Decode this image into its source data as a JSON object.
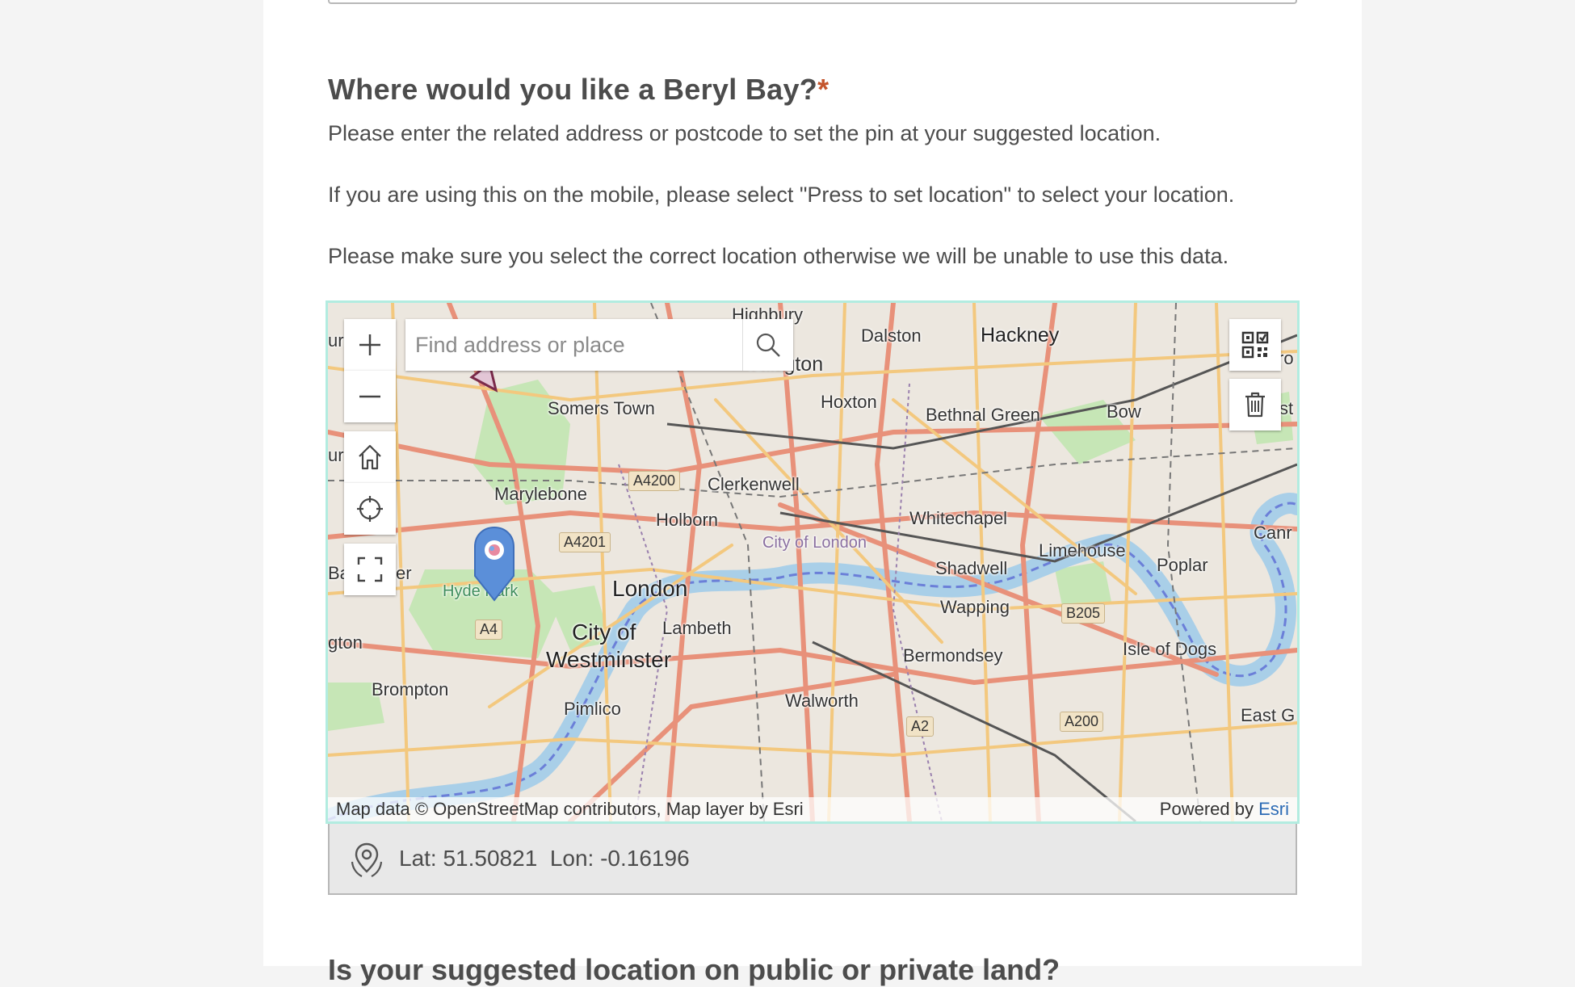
{
  "question": {
    "title": "Where would you like a Beryl Bay?",
    "required_mark": "*",
    "descriptions": [
      "Please enter the related address or postcode to set the pin at your suggested location.",
      "If you are using this on the mobile, please select \"Press to set location\" to select your location.",
      "Please make sure you select the correct location otherwise we will be unable to use this data."
    ]
  },
  "map": {
    "search_placeholder": "Find address or place",
    "labels": {
      "highbury": "Highbury",
      "dalston": "Dalston",
      "hackney": "Hackney",
      "islington": "Islington",
      "hoxton": "Hoxton",
      "somers_town": "Somers Town",
      "bethnal_green": "Bethnal Green",
      "bow": "Bow",
      "clerkenwell": "Clerkenwell",
      "marylebone": "Marylebone",
      "holborn": "Holborn",
      "whitechapel": "Whitechapel",
      "city_of_london": "City of London",
      "limehouse": "Limehouse",
      "poplar": "Poplar",
      "shadwell": "Shadwell",
      "hyde_park": "Hyde Park",
      "london": "London",
      "wapping": "Wapping",
      "lambeth": "Lambeth",
      "city_of_westminster_1": "City of",
      "city_of_westminster_2": "Westminster",
      "bermondsey": "Bermondsey",
      "isle_of_dogs": "Isle of Dogs",
      "brompton": "Brompton",
      "pimlico": "Pimlico",
      "walworth": "Walworth",
      "east_g": "East G",
      "edge_ur": "urn",
      "edge_ur2": "ur",
      "edge_ba": "Ba",
      "edge_er": "er",
      "edge_gton": "gton",
      "edge_ro": "ro",
      "edge_st": "st",
      "edge_canr": "Canr"
    },
    "road_shields": {
      "a4200": "A4200",
      "a4201": "A4201",
      "a4": "A4",
      "b205": "B205",
      "a200": "A200",
      "a2": "A2"
    },
    "attribution": "Map data © OpenStreetMap contributors, Map layer by Esri",
    "powered_by": "Powered by",
    "esri": "Esri"
  },
  "coordinates": {
    "text": "Lat: 51.50821  Lon: -0.16196"
  },
  "next_question": {
    "title": "Is your suggested location on public or private land?"
  },
  "colors": {
    "required": "#c4552c",
    "map_border": "#b2ece0",
    "pin": "#5b8fd9",
    "river": "#a9cfe8",
    "park": "#c6e6b6",
    "esri_link": "#2c6bb5"
  },
  "icons": [
    "plus-icon",
    "minus-icon",
    "home-icon",
    "locate-icon",
    "fullscreen-icon",
    "search-icon",
    "qr-code-icon",
    "trash-icon",
    "location-pin-icon",
    "geolocation-icon"
  ]
}
